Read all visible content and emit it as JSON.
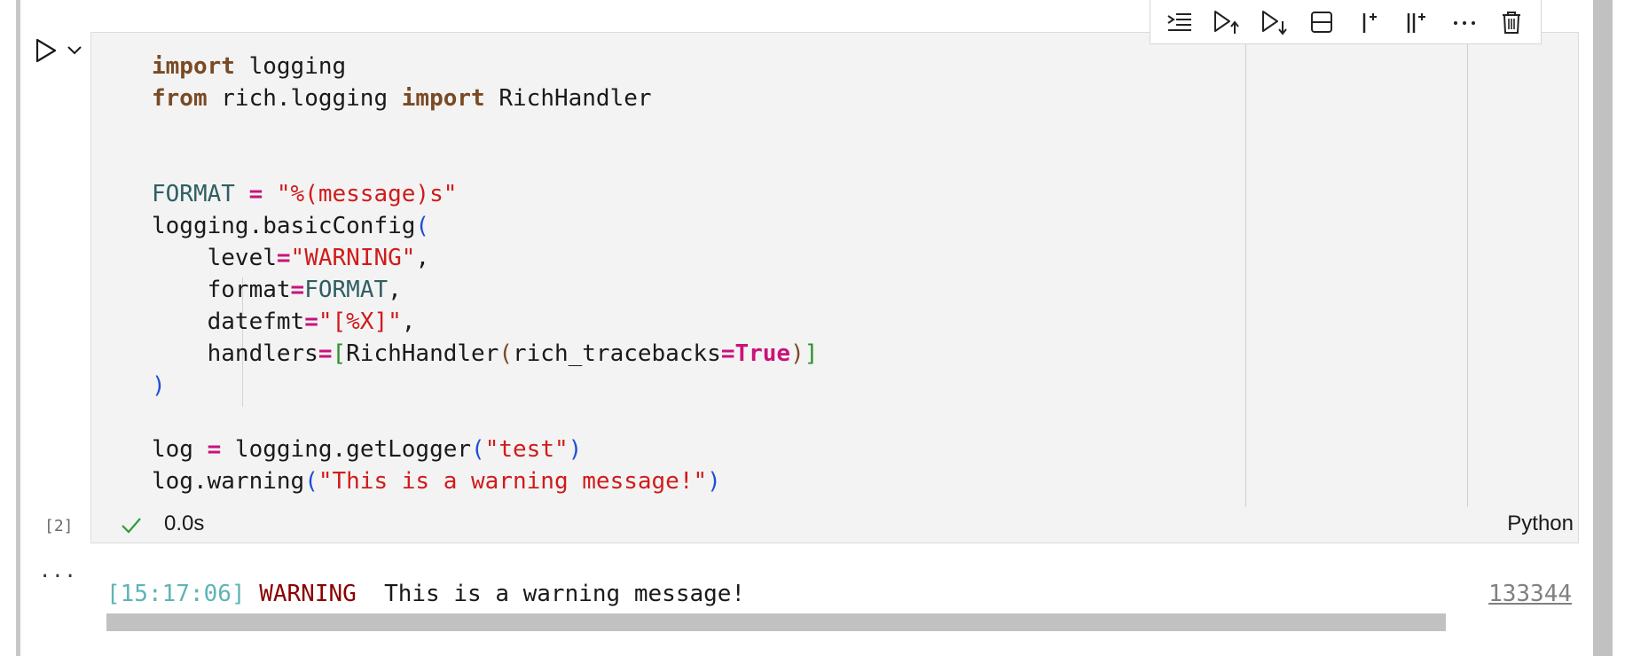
{
  "cell": {
    "execution_count": "[2]",
    "status_time": "0.0s",
    "kernel_language": "Python",
    "code_lines": [
      [
        {
          "t": "import",
          "c": "kw"
        },
        {
          "t": " logging",
          "c": ""
        }
      ],
      [
        {
          "t": "from",
          "c": "kw"
        },
        {
          "t": " rich.logging ",
          "c": ""
        },
        {
          "t": "import",
          "c": "kw"
        },
        {
          "t": " RichHandler",
          "c": ""
        }
      ],
      [],
      [],
      [
        {
          "t": "FORMAT",
          "c": "var"
        },
        {
          "t": " ",
          "c": ""
        },
        {
          "t": "=",
          "c": "op"
        },
        {
          "t": " ",
          "c": ""
        },
        {
          "t": "\"%(message)s\"",
          "c": "str"
        }
      ],
      [
        {
          "t": "logging.basicConfig",
          "c": ""
        },
        {
          "t": "(",
          "c": "p1"
        }
      ],
      [
        {
          "t": "    level",
          "c": ""
        },
        {
          "t": "=",
          "c": "op"
        },
        {
          "t": "\"WARNING\"",
          "c": "str"
        },
        {
          "t": ",",
          "c": ""
        }
      ],
      [
        {
          "t": "    format",
          "c": ""
        },
        {
          "t": "=",
          "c": "op"
        },
        {
          "t": "FORMAT",
          "c": "var"
        },
        {
          "t": ",",
          "c": ""
        }
      ],
      [
        {
          "t": "    datefmt",
          "c": ""
        },
        {
          "t": "=",
          "c": "op"
        },
        {
          "t": "\"[%X]\"",
          "c": "str"
        },
        {
          "t": ",",
          "c": ""
        }
      ],
      [
        {
          "t": "    handlers",
          "c": ""
        },
        {
          "t": "=",
          "c": "op"
        },
        {
          "t": "[",
          "c": "p3"
        },
        {
          "t": "RichHandler",
          "c": ""
        },
        {
          "t": "(",
          "c": "p2"
        },
        {
          "t": "rich_tracebacks",
          "c": ""
        },
        {
          "t": "=",
          "c": "op"
        },
        {
          "t": "True",
          "c": "bool"
        },
        {
          "t": ")",
          "c": "p2"
        },
        {
          "t": "]",
          "c": "p3"
        }
      ],
      [
        {
          "t": ")",
          "c": "p1"
        }
      ],
      [],
      [
        {
          "t": "log",
          "c": ""
        },
        {
          "t": " ",
          "c": ""
        },
        {
          "t": "=",
          "c": "op"
        },
        {
          "t": " logging.getLogger",
          "c": ""
        },
        {
          "t": "(",
          "c": "p1"
        },
        {
          "t": "\"test\"",
          "c": "str"
        },
        {
          "t": ")",
          "c": "p1"
        }
      ],
      [
        {
          "t": "log.warning",
          "c": ""
        },
        {
          "t": "(",
          "c": "p1"
        },
        {
          "t": "\"This is a warning message!\"",
          "c": "str"
        },
        {
          "t": ")",
          "c": "p1"
        }
      ]
    ]
  },
  "toolbar": {
    "items": [
      {
        "name": "run-by-line-icon"
      },
      {
        "name": "execute-above-icon"
      },
      {
        "name": "execute-below-icon"
      },
      {
        "name": "split-cell-icon"
      },
      {
        "name": "add-cell-above-icon"
      },
      {
        "name": "add-cell-below-icon"
      },
      {
        "name": "more-actions-icon"
      },
      {
        "name": "delete-cell-icon"
      }
    ]
  },
  "output": {
    "ellipsis": "...",
    "time": "[15:17:06]",
    "level": "WARNING",
    "message": "This is a warning message!",
    "link": "133344"
  },
  "colors": {
    "keyword": "#7a4a24",
    "string": "#d11b1b",
    "operator": "#c8137a",
    "variable": "#2f5f63",
    "success": "#2e9b3a",
    "log_time": "#5fb4b4",
    "log_warning": "#8b0000"
  }
}
